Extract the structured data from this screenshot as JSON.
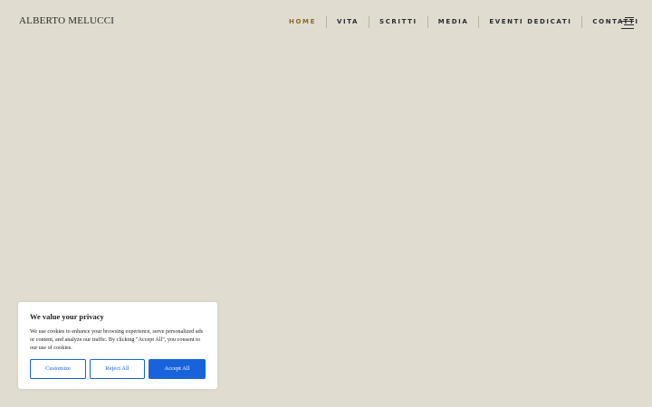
{
  "header": {
    "site_title": "ALBERTO MELUCCI",
    "nav": [
      {
        "label": "HOME",
        "active": true
      },
      {
        "label": "VITA",
        "active": false
      },
      {
        "label": "SCRITTI",
        "active": false
      },
      {
        "label": "MEDIA",
        "active": false
      },
      {
        "label": "EVENTI DEDICATI",
        "active": false
      },
      {
        "label": "CONTATTI",
        "active": false
      }
    ],
    "menu_icon": "hamburger-menu-icon"
  },
  "cookie_banner": {
    "title": "We value your privacy",
    "text": "We use cookies to enhance your browsing experience, serve personalized ads or content, and analyze our traffic. By clicking \"Accept All\", you consent to our use of cookies.",
    "customize_label": "Customize",
    "reject_label": "Reject All",
    "accept_label": "Accept All"
  },
  "colors": {
    "background": "#e0dcd0",
    "active_nav": "#8a6a22",
    "accent_blue": "#1863dc"
  }
}
